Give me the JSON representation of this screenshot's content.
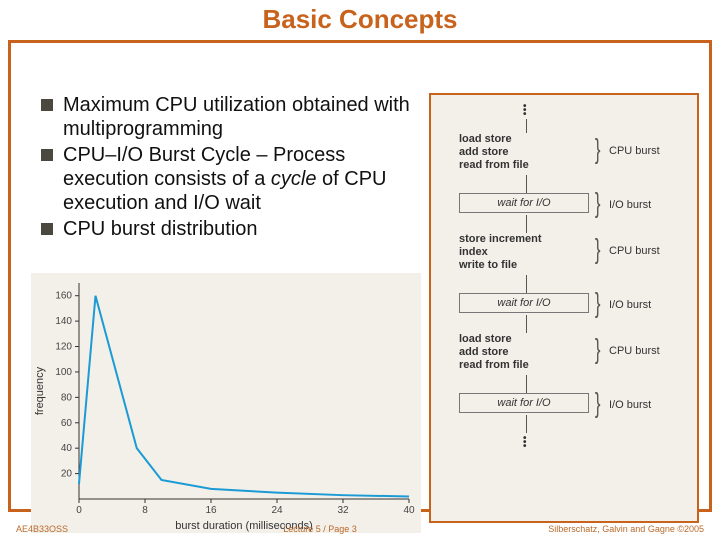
{
  "title": "Basic Concepts",
  "bullets": {
    "b1": "Maximum CPU utilization obtained with multiprogramming",
    "b2_pre": "CPU–I/O Burst Cycle – Process execution consists of a ",
    "b2_em": "cycle",
    "b2_post": " of CPU execution and I/O wait",
    "b3": "CPU burst distribution"
  },
  "chart_data": {
    "type": "line",
    "title": "",
    "xlabel": "burst duration (milliseconds)",
    "ylabel": "frequency",
    "x_ticks": [
      0,
      8,
      16,
      24,
      32,
      40
    ],
    "y_ticks": [
      20,
      40,
      60,
      80,
      100,
      120,
      140,
      160
    ],
    "xlim": [
      0,
      40
    ],
    "ylim": [
      0,
      170
    ],
    "series": [
      {
        "name": "frequency",
        "x": [
          0,
          2,
          7,
          10,
          16,
          24,
          32,
          40
        ],
        "y": [
          12,
          160,
          40,
          15,
          8,
          5,
          3,
          2
        ],
        "color": "#1a9bd6"
      }
    ]
  },
  "diagram": {
    "block1_l1": "load store",
    "block1_l2": "add store",
    "block1_l3": "read from file",
    "wait1": "wait for I/O",
    "block2_l1": "store increment",
    "block2_l2": "index",
    "block2_l3": "write to file",
    "wait2": "wait for I/O",
    "block3_l1": "load store",
    "block3_l2": "add store",
    "block3_l3": "read from file",
    "wait3": "wait for I/O",
    "cpu_label": "CPU burst",
    "io_label": "I/O burst"
  },
  "footer": {
    "left": "AE4B33OSS",
    "center": "Lecture 5 / Page 3",
    "right": "Silberschatz, Galvin and Gagne ©2005"
  }
}
